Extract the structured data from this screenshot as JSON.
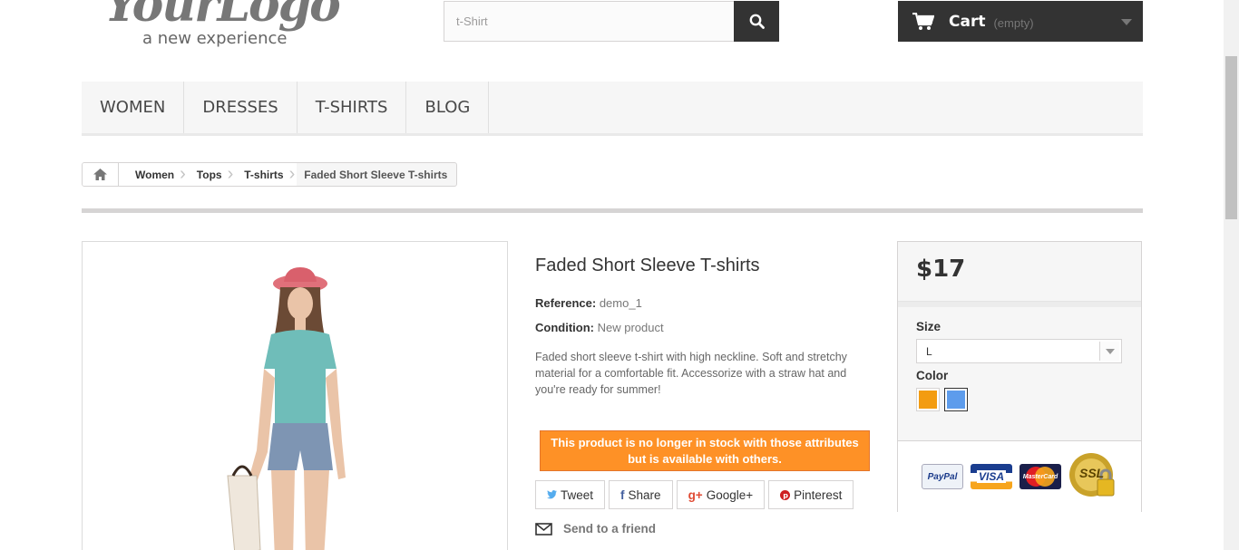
{
  "header": {
    "logo_text": "YourLogo",
    "logo_tagline": "a new experience",
    "search_value": "t-Shirt",
    "cart_label": "Cart",
    "cart_status": "(empty)"
  },
  "menu": {
    "items": [
      "WOMEN",
      "DRESSES",
      "T-SHIRTS",
      "BLOG"
    ]
  },
  "breadcrumb": {
    "items": [
      "Women",
      "Tops",
      "T-shirts"
    ],
    "current": "Faded Short Sleeve T-shirts"
  },
  "product": {
    "title": "Faded Short Sleeve T-shirts",
    "reference_label": "Reference:",
    "reference_value": "demo_1",
    "condition_label": "Condition:",
    "condition_value": "New product",
    "description": "Faded short sleeve t-shirt with high neckline. Soft and stretchy material for a comfortable fit. Accessorize with a straw hat and you're ready for summer!",
    "stock_alert": "This product is no longer in stock with those attributes but is available with others."
  },
  "social": {
    "tweet": "Tweet",
    "share": "Share",
    "google": "Google+",
    "pinterest": "Pinterest"
  },
  "send_to_friend": "Send to a friend",
  "buy_box": {
    "price": "$17",
    "size_label": "Size",
    "size_value": "L",
    "color_label": "Color",
    "colors": [
      "#f39c11",
      "#5d9cec"
    ],
    "selected_color": 1,
    "payment_paypal": "PayPal",
    "payment_visa": "VISA",
    "payment_mastercard": "MasterCard",
    "payment_ssl": "SSL"
  }
}
